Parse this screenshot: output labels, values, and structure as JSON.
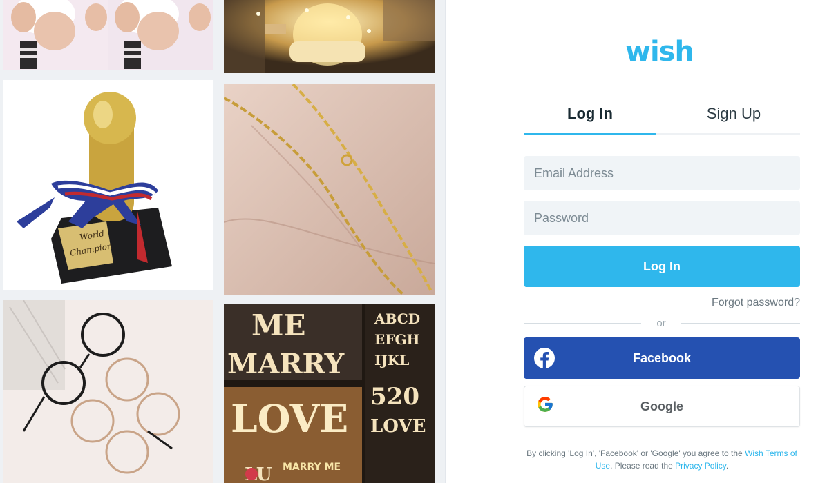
{
  "brand": {
    "logo": "wish",
    "accent": "#2fb7ec",
    "facebook_blue": "#2551b1"
  },
  "products": [
    {
      "name": "baby-legs-photo"
    },
    {
      "name": "led-lamp-photo"
    },
    {
      "name": "gold-trophy-photo",
      "plaque_text": "World Champion"
    },
    {
      "name": "gold-chain-necklace-photo"
    },
    {
      "name": "round-glasses-photo"
    },
    {
      "name": "marquee-letters-photo",
      "sign_text": [
        "ME",
        "MARRY",
        "LOVE",
        "ABCD",
        "EFGH",
        "IJKL",
        "520",
        "LOVE",
        "MARRY ME",
        "LU"
      ]
    }
  ],
  "auth": {
    "tabs": [
      {
        "label": "Log In",
        "active": true
      },
      {
        "label": "Sign Up",
        "active": false
      }
    ],
    "email_placeholder": "Email Address",
    "password_placeholder": "Password",
    "login_button": "Log In",
    "forgot_password": "Forgot password?",
    "or_label": "or",
    "facebook_button": "Facebook",
    "google_button": "Google",
    "legal": {
      "prefix": "By clicking 'Log In', 'Facebook' or 'Google' you agree to the ",
      "terms_link": "Wish Terms of Use",
      "middle": ". Please read the ",
      "privacy_link": "Privacy Policy",
      "suffix": "."
    }
  }
}
